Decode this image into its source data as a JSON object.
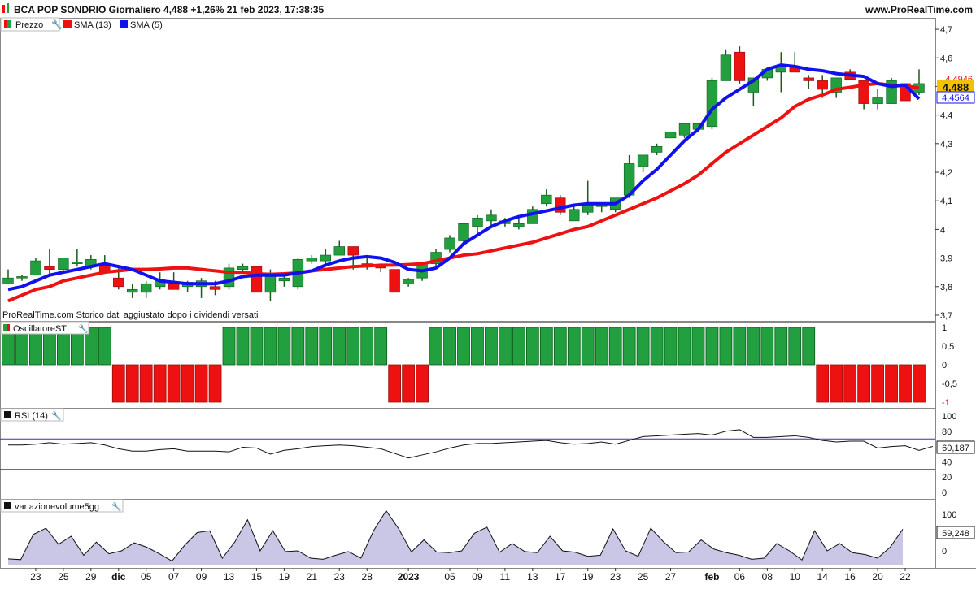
{
  "header": {
    "title": "BCA POP SONDRIO Giornaliero 4,488 +1,26% 21 feb 2023, 17:38:35",
    "site": "www.ProRealTime.com"
  },
  "panels": {
    "price": {
      "legend": [
        {
          "label": "Prezzo",
          "color": "#22a040"
        },
        {
          "label": "SMA (13)",
          "color": "#ee1111"
        },
        {
          "label": "SMA (5)",
          "color": "#1111ee"
        }
      ],
      "note": "ProRealTime.com Storico dati aggiustato dopo i dividendi versati",
      "y_ticks": [
        "4,7",
        "4,6",
        "4,5",
        "4,4",
        "4,3",
        "4,2",
        "4,1",
        "4",
        "3,9",
        "3,8",
        "3,7"
      ],
      "y_tick_values": [
        4.7,
        4.6,
        4.5,
        4.4,
        4.3,
        4.2,
        4.1,
        4.0,
        3.9,
        3.8,
        3.7
      ],
      "last_price_label": "4,488",
      "sma13_label": "4,4946",
      "sma5_label": "4,4564"
    },
    "sti": {
      "legend": "OscillatoreSTI",
      "y_ticks": [
        "1",
        "0,5",
        "0",
        "-0,5",
        "-1"
      ]
    },
    "rsi": {
      "legend": "RSI (14)",
      "y_ticks": [
        "100",
        "80",
        "60",
        "40",
        "20",
        "0"
      ],
      "value_label": "60,187",
      "levels": [
        70,
        30
      ]
    },
    "volume": {
      "legend": "variazionevolume5gg",
      "y_ticks": [
        "100",
        "50",
        "0"
      ],
      "value_label": "59,248"
    }
  },
  "x_axis": {
    "labels": [
      {
        "i": 2,
        "text": "23"
      },
      {
        "i": 4,
        "text": "25"
      },
      {
        "i": 6,
        "text": "29"
      },
      {
        "i": 8,
        "text": "dic",
        "bold": true
      },
      {
        "i": 10,
        "text": "05"
      },
      {
        "i": 12,
        "text": "07"
      },
      {
        "i": 14,
        "text": "09"
      },
      {
        "i": 16,
        "text": "13"
      },
      {
        "i": 18,
        "text": "15"
      },
      {
        "i": 20,
        "text": "19"
      },
      {
        "i": 22,
        "text": "21"
      },
      {
        "i": 24,
        "text": "23"
      },
      {
        "i": 26,
        "text": "28"
      },
      {
        "i": 29,
        "text": "2023",
        "bold": true
      },
      {
        "i": 32,
        "text": "05"
      },
      {
        "i": 34,
        "text": "09"
      },
      {
        "i": 36,
        "text": "11"
      },
      {
        "i": 38,
        "text": "13"
      },
      {
        "i": 40,
        "text": "17"
      },
      {
        "i": 42,
        "text": "19"
      },
      {
        "i": 44,
        "text": "23"
      },
      {
        "i": 46,
        "text": "25"
      },
      {
        "i": 48,
        "text": "27"
      },
      {
        "i": 51,
        "text": "feb",
        "bold": true
      },
      {
        "i": 53,
        "text": "06"
      },
      {
        "i": 55,
        "text": "08"
      },
      {
        "i": 57,
        "text": "10"
      },
      {
        "i": 59,
        "text": "14"
      },
      {
        "i": 61,
        "text": "16"
      },
      {
        "i": 63,
        "text": "20"
      },
      {
        "i": 65,
        "text": "22"
      }
    ]
  },
  "colors": {
    "up": "#22a040",
    "down": "#ee1111",
    "sma13": "#ee1111",
    "sma5": "#1111ee",
    "last_badge": "#f2c200"
  },
  "chart_data": [
    {
      "type": "candlestick",
      "title": "BCA POP SONDRIO Giornaliero",
      "ylim": [
        3.68,
        4.74
      ],
      "ohlc": [
        [
          3.81,
          3.86,
          3.81,
          3.83
        ],
        [
          3.83,
          3.84,
          3.82,
          3.835
        ],
        [
          3.84,
          3.9,
          3.84,
          3.89
        ],
        [
          3.87,
          3.93,
          3.84,
          3.86
        ],
        [
          3.86,
          3.9,
          3.85,
          3.9
        ],
        [
          3.88,
          3.93,
          3.87,
          3.885
        ],
        [
          3.87,
          3.91,
          3.86,
          3.895
        ],
        [
          3.88,
          3.91,
          3.86,
          3.85
        ],
        [
          3.83,
          3.87,
          3.79,
          3.8
        ],
        [
          3.78,
          3.81,
          3.76,
          3.79
        ],
        [
          3.78,
          3.82,
          3.76,
          3.81
        ],
        [
          3.8,
          3.85,
          3.79,
          3.825
        ],
        [
          3.81,
          3.85,
          3.79,
          3.79
        ],
        [
          3.8,
          3.82,
          3.78,
          3.815
        ],
        [
          3.8,
          3.83,
          3.76,
          3.82
        ],
        [
          3.8,
          3.82,
          3.77,
          3.79
        ],
        [
          3.8,
          3.88,
          3.79,
          3.865
        ],
        [
          3.86,
          3.88,
          3.85,
          3.87
        ],
        [
          3.87,
          3.87,
          3.78,
          3.78
        ],
        [
          3.78,
          3.86,
          3.75,
          3.835
        ],
        [
          3.82,
          3.84,
          3.8,
          3.83
        ],
        [
          3.8,
          3.9,
          3.79,
          3.895
        ],
        [
          3.89,
          3.91,
          3.88,
          3.9
        ],
        [
          3.89,
          3.93,
          3.88,
          3.91
        ],
        [
          3.91,
          3.96,
          3.91,
          3.94
        ],
        [
          3.94,
          3.94,
          3.86,
          3.91
        ],
        [
          3.88,
          3.9,
          3.86,
          3.875
        ],
        [
          3.87,
          3.88,
          3.85,
          3.865
        ],
        [
          3.86,
          3.86,
          3.78,
          3.78
        ],
        [
          3.81,
          3.83,
          3.8,
          3.825
        ],
        [
          3.83,
          3.88,
          3.82,
          3.88
        ],
        [
          3.88,
          3.93,
          3.87,
          3.92
        ],
        [
          3.93,
          3.98,
          3.92,
          3.97
        ],
        [
          3.96,
          4.0,
          3.95,
          4.02
        ],
        [
          4.01,
          4.05,
          3.98,
          4.04
        ],
        [
          4.03,
          4.07,
          4.01,
          4.05
        ],
        [
          4.02,
          4.04,
          4.01,
          4.03
        ],
        [
          4.01,
          4.04,
          4.0,
          4.02
        ],
        [
          4.02,
          4.08,
          4.02,
          4.07
        ],
        [
          4.09,
          4.14,
          4.08,
          4.12
        ],
        [
          4.11,
          4.12,
          4.05,
          4.06
        ],
        [
          4.03,
          4.08,
          4.03,
          4.07
        ],
        [
          4.06,
          4.17,
          4.05,
          4.09
        ],
        [
          4.08,
          4.09,
          4.06,
          4.09
        ],
        [
          4.07,
          4.1,
          4.06,
          4.11
        ],
        [
          4.12,
          4.26,
          4.11,
          4.23
        ],
        [
          4.22,
          4.26,
          4.2,
          4.26
        ],
        [
          4.27,
          4.3,
          4.26,
          4.29
        ],
        [
          4.32,
          4.34,
          4.32,
          4.34
        ],
        [
          4.33,
          4.37,
          4.32,
          4.37
        ],
        [
          4.35,
          4.36,
          4.34,
          4.37
        ],
        [
          4.36,
          4.53,
          4.35,
          4.52
        ],
        [
          4.52,
          4.63,
          4.52,
          4.61
        ],
        [
          4.62,
          4.64,
          4.51,
          4.52
        ],
        [
          4.48,
          4.53,
          4.43,
          4.53
        ],
        [
          4.53,
          4.56,
          4.52,
          4.56
        ],
        [
          4.55,
          4.62,
          4.48,
          4.57
        ],
        [
          4.57,
          4.62,
          4.55,
          4.55
        ],
        [
          4.53,
          4.54,
          4.49,
          4.52
        ],
        [
          4.52,
          4.54,
          4.46,
          4.49
        ],
        [
          4.48,
          4.52,
          4.46,
          4.53
        ],
        [
          4.55,
          4.56,
          4.54,
          4.525
        ],
        [
          4.52,
          4.52,
          4.42,
          4.44
        ],
        [
          4.44,
          4.49,
          4.42,
          4.46
        ],
        [
          4.44,
          4.53,
          4.44,
          4.52
        ],
        [
          4.51,
          4.51,
          4.45,
          4.45
        ],
        [
          4.48,
          4.56,
          4.47,
          4.51
        ]
      ],
      "sma13": [
        3.75,
        3.77,
        3.79,
        3.8,
        3.82,
        3.83,
        3.84,
        3.85,
        3.855,
        3.86,
        3.86,
        3.862,
        3.865,
        3.865,
        3.86,
        3.855,
        3.85,
        3.85,
        3.845,
        3.843,
        3.845,
        3.848,
        3.855,
        3.86,
        3.865,
        3.87,
        3.872,
        3.875,
        3.875,
        3.877,
        3.88,
        3.89,
        3.9,
        3.91,
        3.915,
        3.925,
        3.935,
        3.945,
        3.955,
        3.97,
        3.985,
        4.0,
        4.01,
        4.03,
        4.05,
        4.07,
        4.09,
        4.11,
        4.135,
        4.16,
        4.19,
        4.23,
        4.27,
        4.3,
        4.33,
        4.36,
        4.39,
        4.43,
        4.455,
        4.47,
        4.49,
        4.497,
        4.505,
        4.51,
        4.505,
        4.502,
        4.4946
      ],
      "sma5": [
        3.79,
        3.8,
        3.82,
        3.84,
        3.85,
        3.86,
        3.87,
        3.88,
        3.87,
        3.86,
        3.84,
        3.82,
        3.815,
        3.81,
        3.81,
        3.81,
        3.82,
        3.835,
        3.84,
        3.84,
        3.84,
        3.848,
        3.855,
        3.875,
        3.89,
        3.9,
        3.905,
        3.9,
        3.885,
        3.86,
        3.855,
        3.865,
        3.9,
        3.95,
        3.98,
        4.01,
        4.03,
        4.045,
        4.055,
        4.065,
        4.075,
        4.085,
        4.09,
        4.09,
        4.09,
        4.12,
        4.17,
        4.21,
        4.26,
        4.31,
        4.35,
        4.42,
        4.46,
        4.49,
        4.52,
        4.56,
        4.575,
        4.57,
        4.56,
        4.555,
        4.545,
        4.54,
        4.535,
        4.51,
        4.5,
        4.505,
        4.4564
      ],
      "last": 4.488
    },
    {
      "type": "bar",
      "title": "OscillatoreSTI",
      "ylim": [
        -1,
        1
      ],
      "values": [
        1,
        1,
        1,
        1,
        1,
        1,
        1,
        1,
        -1,
        -1,
        -1,
        -1,
        -1,
        -1,
        -1,
        -1,
        1,
        1,
        1,
        1,
        1,
        1,
        1,
        1,
        1,
        1,
        1,
        1,
        -1,
        -1,
        -1,
        1,
        1,
        1,
        1,
        1,
        1,
        1,
        1,
        1,
        1,
        1,
        1,
        1,
        1,
        1,
        1,
        1,
        1,
        1,
        1,
        1,
        1,
        1,
        1,
        1,
        1,
        1,
        1,
        -1,
        -1,
        -1,
        -1,
        -1,
        -1,
        -1,
        -1
      ]
    },
    {
      "type": "line",
      "title": "RSI (14)",
      "ylim": [
        0,
        100
      ],
      "values": [
        62,
        62,
        63,
        65,
        63,
        64,
        65,
        62,
        57,
        54,
        54,
        56,
        57,
        54,
        54,
        54,
        53,
        59,
        58,
        50,
        55,
        57,
        60,
        61,
        62,
        61,
        59,
        57,
        51,
        45,
        49,
        53,
        58,
        62,
        64,
        64,
        65,
        66,
        67,
        68,
        65,
        63,
        64,
        66,
        63,
        68,
        73,
        74,
        75,
        76,
        77,
        75,
        80,
        82,
        72,
        72,
        73,
        74,
        72,
        68,
        66,
        67,
        67,
        58,
        60,
        61,
        55,
        60.187
      ]
    },
    {
      "type": "area",
      "title": "variazionevolume5gg",
      "ylim": [
        -40,
        120
      ],
      "values": [
        -22,
        -24,
        45,
        62,
        18,
        40,
        -12,
        24,
        -8,
        0,
        22,
        10,
        -8,
        -28,
        15,
        50,
        55,
        -20,
        25,
        85,
        0,
        55,
        -2,
        0,
        -20,
        -23,
        -12,
        -2,
        -20,
        55,
        110,
        60,
        -3,
        30,
        -3,
        -5,
        0,
        48,
        65,
        -4,
        20,
        -2,
        -5,
        40,
        0,
        -4,
        -15,
        -12,
        60,
        0,
        -15,
        62,
        25,
        -5,
        -3,
        30,
        5,
        -5,
        -12,
        -23,
        -20,
        20,
        0,
        -25,
        55,
        0,
        20,
        -5,
        -10,
        -20,
        10,
        59.248
      ]
    }
  ]
}
